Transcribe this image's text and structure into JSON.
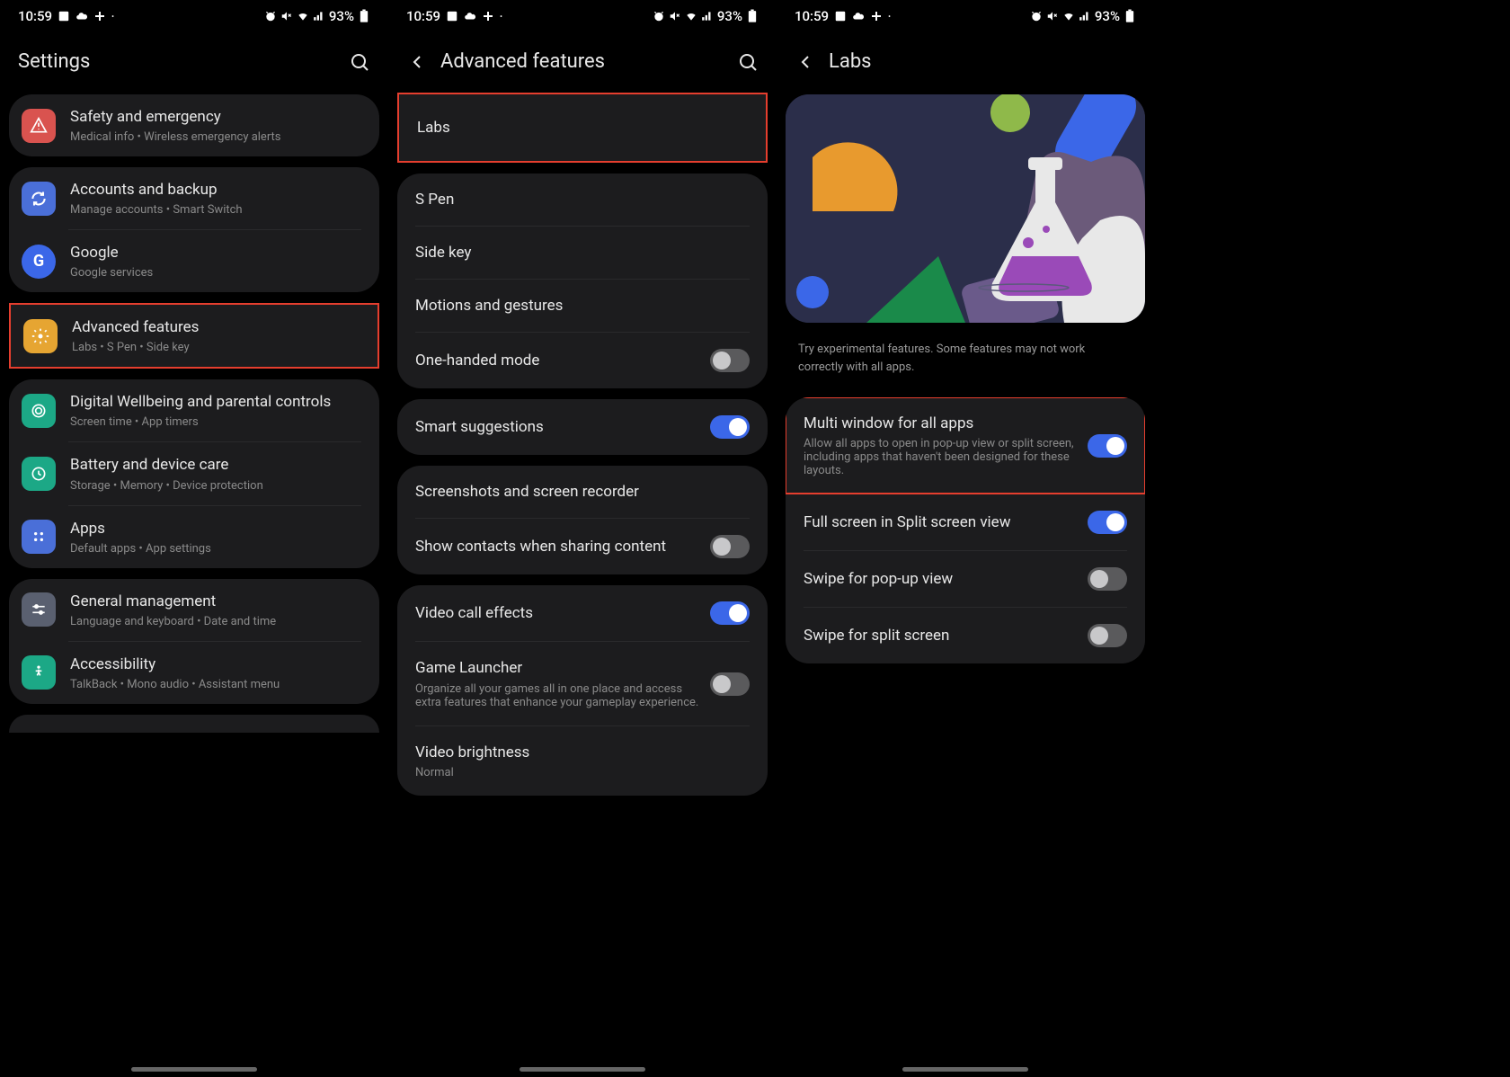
{
  "status": {
    "time": "10:59",
    "battery": "93%"
  },
  "screen1": {
    "title": "Settings",
    "groups": [
      {
        "items": [
          {
            "icon": "alert",
            "color": "red",
            "title": "Safety and emergency",
            "sub": "Medical info  •  Wireless emergency alerts"
          }
        ]
      },
      {
        "items": [
          {
            "icon": "sync",
            "color": "blue",
            "title": "Accounts and backup",
            "sub": "Manage accounts  •  Smart Switch"
          },
          {
            "icon": "google",
            "color": "google",
            "title": "Google",
            "sub": "Google services"
          }
        ]
      },
      {
        "highlight": true,
        "items": [
          {
            "icon": "gear",
            "color": "orange",
            "title": "Advanced features",
            "sub": "Labs  •  S Pen  •  Side key"
          }
        ]
      },
      {
        "items": [
          {
            "icon": "heart",
            "color": "green",
            "title": "Digital Wellbeing and parental controls",
            "sub": "Screen time  •  App timers"
          },
          {
            "icon": "battery",
            "color": "teal",
            "title": "Battery and device care",
            "sub": "Storage  •  Memory  •  Device protection"
          },
          {
            "icon": "grid",
            "color": "bluebox",
            "title": "Apps",
            "sub": "Default apps  •  App settings"
          }
        ]
      },
      {
        "items": [
          {
            "icon": "sliders",
            "color": "grey",
            "title": "General management",
            "sub": "Language and keyboard  •  Date and time"
          },
          {
            "icon": "access",
            "color": "access",
            "title": "Accessibility",
            "sub": "TalkBack  •  Mono audio  •  Assistant menu"
          }
        ]
      }
    ]
  },
  "screen2": {
    "title": "Advanced features",
    "groups": [
      {
        "highlight": true,
        "items": [
          {
            "title": "Labs"
          }
        ]
      },
      {
        "items": [
          {
            "title": "S Pen"
          },
          {
            "title": "Side key"
          },
          {
            "title": "Motions and gestures"
          },
          {
            "title": "One-handed mode",
            "toggle": "off"
          }
        ]
      },
      {
        "items": [
          {
            "title": "Smart suggestions",
            "toggle": "on"
          }
        ]
      },
      {
        "items": [
          {
            "title": "Screenshots and screen recorder"
          },
          {
            "title": "Show contacts when sharing content",
            "toggle": "off"
          }
        ]
      },
      {
        "items": [
          {
            "title": "Video call effects",
            "toggle": "on"
          },
          {
            "title": "Game Launcher",
            "sub": "Organize all your games all in one place and access extra features that enhance your gameplay experience.",
            "toggle": "off"
          },
          {
            "title": "Video brightness",
            "sub": "Normal"
          }
        ]
      }
    ]
  },
  "screen3": {
    "title": "Labs",
    "description": "Try experimental features. Some features may not work correctly with all apps.",
    "items": [
      {
        "highlight": true,
        "title": "Multi window for all apps",
        "sub": "Allow all apps to open in pop-up view or split screen, including apps that haven't been designed for these layouts.",
        "toggle": "on"
      },
      {
        "title": "Full screen in Split screen view",
        "toggle": "on"
      },
      {
        "title": "Swipe for pop-up view",
        "toggle": "off"
      },
      {
        "title": "Swipe for split screen",
        "toggle": "off"
      }
    ]
  }
}
